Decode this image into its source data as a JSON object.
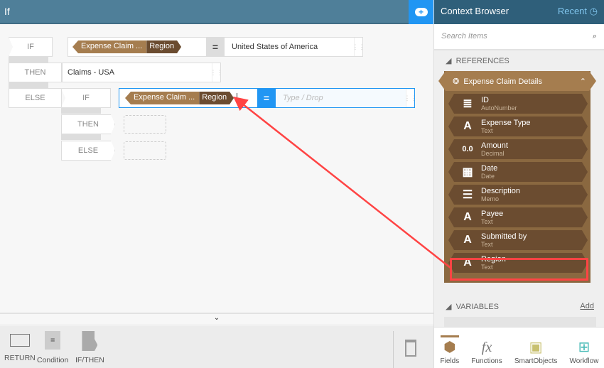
{
  "header": {
    "title": "If"
  },
  "rule": {
    "if_label": "IF",
    "then_label": "THEN",
    "else_label": "ELSE",
    "cond1": {
      "token_parent": "Expense Claim ...",
      "token_field": "Region",
      "operator": "=",
      "value": "United States of America"
    },
    "then_value": "Claims - USA",
    "nested": {
      "if_label": "IF",
      "then_label": "THEN",
      "else_label": "ELSE",
      "token_parent": "Expense Claim ...",
      "token_field": "Region",
      "operator": "=",
      "placeholder": "Type / Drop"
    }
  },
  "toolbar": {
    "return": "RETURN",
    "condition": "Condition",
    "condition_glyph": "=",
    "ifthen": "IF/THEN"
  },
  "context": {
    "title": "Context Browser",
    "recent": "Recent",
    "search_placeholder": "Search Items",
    "references": "REFERENCES",
    "group": "Expense Claim Details",
    "items": [
      {
        "name": "ID",
        "type": "AutoNumber",
        "icon": "autonumber-icon",
        "glyph": "≣"
      },
      {
        "name": "Expense Type",
        "type": "Text",
        "icon": "text-icon",
        "glyph": "A"
      },
      {
        "name": "Amount",
        "type": "Decimal",
        "icon": "decimal-icon",
        "glyph": "0.0"
      },
      {
        "name": "Date",
        "type": "Date",
        "icon": "calendar-icon",
        "glyph": "▦"
      },
      {
        "name": "Description",
        "type": "Memo",
        "icon": "memo-icon",
        "glyph": "☰"
      },
      {
        "name": "Payee",
        "type": "Text",
        "icon": "text-icon",
        "glyph": "A"
      },
      {
        "name": "Submitted by",
        "type": "Text",
        "icon": "text-icon",
        "glyph": "A"
      },
      {
        "name": "Region",
        "type": "Text",
        "icon": "text-icon",
        "glyph": "A"
      }
    ],
    "variables": "VARIABLES",
    "add": "Add",
    "nav": [
      {
        "label": "Fields",
        "glyph": "⬢"
      },
      {
        "label": "Functions",
        "glyph": "fx"
      },
      {
        "label": "SmartObjects",
        "glyph": "▣"
      },
      {
        "label": "Workflow",
        "glyph": "⊞"
      }
    ]
  },
  "colors": {
    "header": "#4f7f99",
    "accent": "#2196f3",
    "token": "#a57d4f",
    "token_dark": "#6b4c30",
    "highlight": "#f44444"
  }
}
